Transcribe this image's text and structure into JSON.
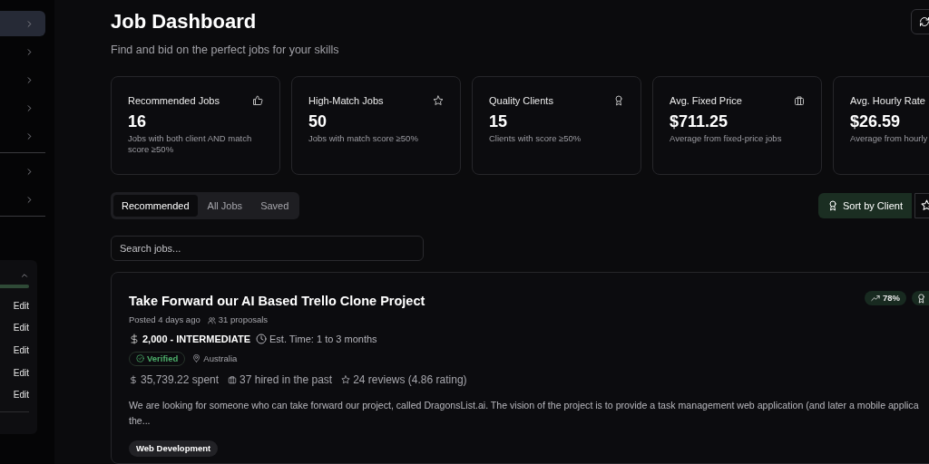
{
  "sidebar": {
    "groups": [
      {
        "items": [
          {
            "selected": true
          },
          {
            "selected": false
          },
          {
            "selected": false
          },
          {
            "selected": false
          },
          {
            "selected": false
          }
        ]
      },
      {
        "items": [
          {
            "selected": false
          },
          {
            "selected": false
          }
        ]
      }
    ],
    "panel": {
      "expanded": true,
      "progress": {
        "level": 1
      },
      "rows": [
        {
          "action": "Edit"
        },
        {
          "action": "Edit"
        },
        {
          "action": "Edit"
        },
        {
          "action": "Edit"
        },
        {
          "action": "Edit"
        }
      ]
    }
  },
  "header": {
    "title": "Job Dashboard",
    "subtitle": "Find and bid on the perfect jobs for your skills"
  },
  "stats": [
    {
      "title": "Recommended Jobs",
      "value": "16",
      "note": "Jobs with both client AND match score ≥50%"
    },
    {
      "title": "High-Match Jobs",
      "value": "50",
      "note": "Jobs with match score ≥50%"
    },
    {
      "title": "Quality Clients",
      "value": "15",
      "note": "Clients with score ≥50%"
    },
    {
      "title": "Avg. Fixed Price",
      "value": "$711.25",
      "note": "Average from fixed-price jobs"
    },
    {
      "title": "Avg. Hourly Rate",
      "value": "$26.59",
      "note": "Average from hourly"
    }
  ],
  "tabs": [
    {
      "label": "Recommended",
      "selected": true
    },
    {
      "label": "All Jobs",
      "selected": false
    },
    {
      "label": "Saved",
      "selected": false
    }
  ],
  "sort_button": {
    "label": "Sort by Client",
    "selected": true
  },
  "search": {
    "placeholder": "Search jobs..."
  },
  "job": {
    "title": "Take Forward our AI Based Trello Clone Project",
    "posted": "Posted 4 days ago",
    "proposals": "31 proposals",
    "budget": "2,000 - INTERMEDIATE",
    "duration": "Est. Time: 1 to 3 months",
    "verified": true,
    "verified_label": "Verified",
    "location": "Australia",
    "spent": "35,739.22 spent",
    "hired": "37 hired in the past",
    "reviews": "24 reviews (4.86 rating)",
    "description_lines": [
      "We are looking for someone who can take forward our project, called DragonsList.ai. The vision of the project is to provide a task management web application (and later a mobile applica",
      "the..."
    ],
    "tags": [
      "Web Development"
    ],
    "match": "78%"
  }
}
